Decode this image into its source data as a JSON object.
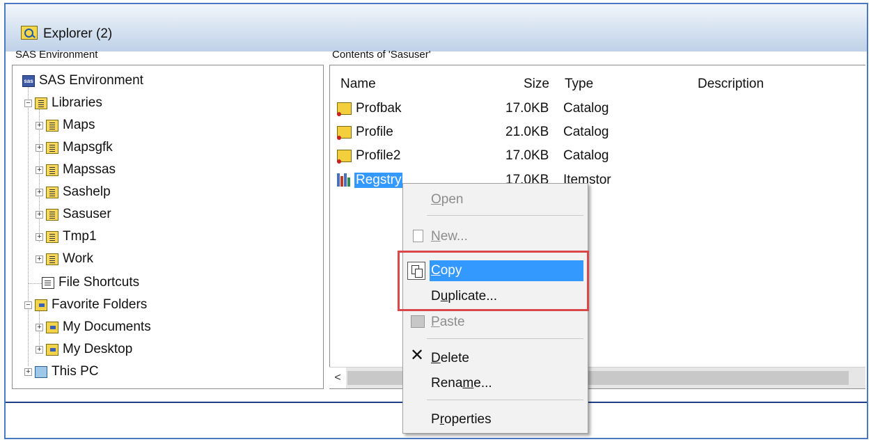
{
  "window": {
    "title": "Explorer (2)"
  },
  "tree_panel": {
    "label": "SAS Environment",
    "items": [
      {
        "label": "SAS Environment",
        "icon": "sas-icon",
        "expander": ""
      },
      {
        "label": "Libraries",
        "icon": "library-icon",
        "expander": "−"
      },
      {
        "label": "Maps",
        "icon": "library-icon",
        "expander": "+"
      },
      {
        "label": "Mapsgfk",
        "icon": "library-icon",
        "expander": "+"
      },
      {
        "label": "Mapssas",
        "icon": "library-icon",
        "expander": "+"
      },
      {
        "label": "Sashelp",
        "icon": "library-icon",
        "expander": "+"
      },
      {
        "label": "Sasuser",
        "icon": "library-icon",
        "expander": "+"
      },
      {
        "label": "Tmp1",
        "icon": "library-icon",
        "expander": "+"
      },
      {
        "label": "Work",
        "icon": "library-icon",
        "expander": "+"
      },
      {
        "label": "File Shortcuts",
        "icon": "file-shortcuts-icon",
        "expander": ""
      },
      {
        "label": "Favorite Folders",
        "icon": "favorite-folder-icon",
        "expander": "−"
      },
      {
        "label": "My Documents",
        "icon": "favorite-folder-icon",
        "expander": "+"
      },
      {
        "label": "My Desktop",
        "icon": "favorite-folder-icon",
        "expander": "+"
      },
      {
        "label": "This PC",
        "icon": "computer-icon",
        "expander": "+"
      }
    ]
  },
  "contents_panel": {
    "label": "Contents of 'Sasuser'",
    "columns": {
      "name": "Name",
      "size": "Size",
      "type": "Type",
      "description": "Description"
    },
    "rows": [
      {
        "name": "Profbak",
        "size": "17.0KB",
        "type": "Catalog",
        "icon": "catalog-icon"
      },
      {
        "name": "Profile",
        "size": "21.0KB",
        "type": "Catalog",
        "icon": "catalog-icon"
      },
      {
        "name": "Profile2",
        "size": "17.0KB",
        "type": "Catalog",
        "icon": "catalog-icon"
      },
      {
        "name": "Regstry",
        "size": "17.0KB",
        "type": "Itemstor",
        "icon": "itemstor-icon",
        "selected": true
      }
    ],
    "scroll_left_glyph": "<"
  },
  "context_menu": {
    "items": [
      {
        "pre": "",
        "u": "O",
        "post": "pen",
        "state": "disabled"
      },
      {
        "pre": "",
        "u": "N",
        "post": "ew...",
        "state": "disabled",
        "icon": "new-document-icon"
      },
      {
        "pre": "",
        "u": "C",
        "post": "opy",
        "state": "highlighted",
        "icon": "copy-icon"
      },
      {
        "pre": "D",
        "u": "u",
        "post": "plicate...",
        "state": "normal"
      },
      {
        "pre": "",
        "u": "P",
        "post": "aste",
        "state": "disabled",
        "icon": "paste-icon"
      },
      {
        "pre": "",
        "u": "D",
        "post": "elete",
        "state": "normal",
        "icon": "delete-icon",
        "glyph": "✕"
      },
      {
        "pre": "Rena",
        "u": "m",
        "post": "e...",
        "state": "normal"
      },
      {
        "pre": "P",
        "u": "r",
        "post": "operties",
        "state": "normal"
      }
    ]
  },
  "colors": {
    "selection": "#3399ff",
    "annotation_box": "#d9474a",
    "window_border": "#4a79c4"
  }
}
